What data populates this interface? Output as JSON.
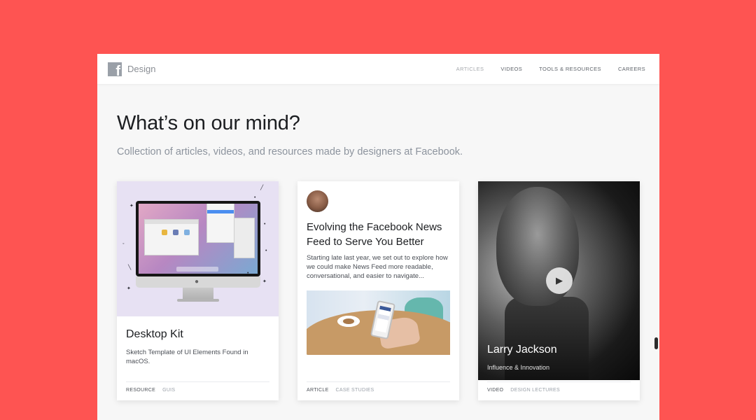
{
  "header": {
    "brand": "Design",
    "nav": [
      "ARTICLES",
      "VIDEOS",
      "TOOLS & RESOURCES",
      "CAREERS"
    ]
  },
  "hero": {
    "title": "What’s on our mind?",
    "subtitle": "Collection of articles, videos, and resources made by designers at Facebook."
  },
  "cards": [
    {
      "title": "Desktop Kit",
      "description": "Sketch Template of UI Elements Found in macOS.",
      "tag": "RESOURCE",
      "subtag": "GUIS"
    },
    {
      "title": "Evolving the Facebook News Feed to Serve You Better",
      "description": "Starting late last year, we set out to explore how we could make News Feed more readable, conversational, and easier to navigate...",
      "tag": "ARTICLE",
      "subtag": "CASE STUDIES"
    },
    {
      "title": "Larry Jackson",
      "description": "Influence & Innovation",
      "tag": "VIDEO",
      "subtag": "DESIGN LECTURES"
    }
  ],
  "icons": {
    "logo": "facebook-logo-icon",
    "play": "play-icon",
    "apple": "apple-logo-icon"
  },
  "colors": {
    "background": "#fe5452",
    "window": "#f7f7f7",
    "card": "#ffffff",
    "text_dark": "#1c1e21",
    "text_muted": "#8d949e"
  }
}
